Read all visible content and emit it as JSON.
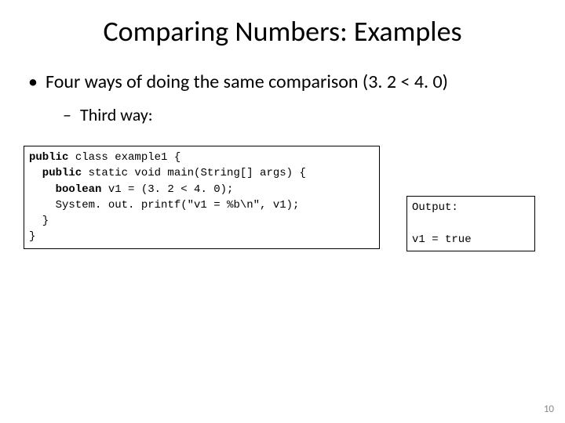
{
  "title": "Comparing Numbers: Examples",
  "bullet1": "Four ways of doing the same comparison (3. 2 < 4. 0)",
  "bullet2": "Third way:",
  "code": {
    "l1a": "public",
    "l1b": " class example1 {",
    "l2a": "  public",
    "l2b": " static void main(String[] args) {",
    "l3a": "    boolean",
    "l3b": " v1 = (3. 2 < 4. 0);",
    "l4": "    System. out. printf(\"v1 = %b\\n\", v1);",
    "l5": "  }",
    "l6": "}"
  },
  "output": {
    "l1": "Output:",
    "l2": "",
    "l3": "v1 = true"
  },
  "page": "10"
}
